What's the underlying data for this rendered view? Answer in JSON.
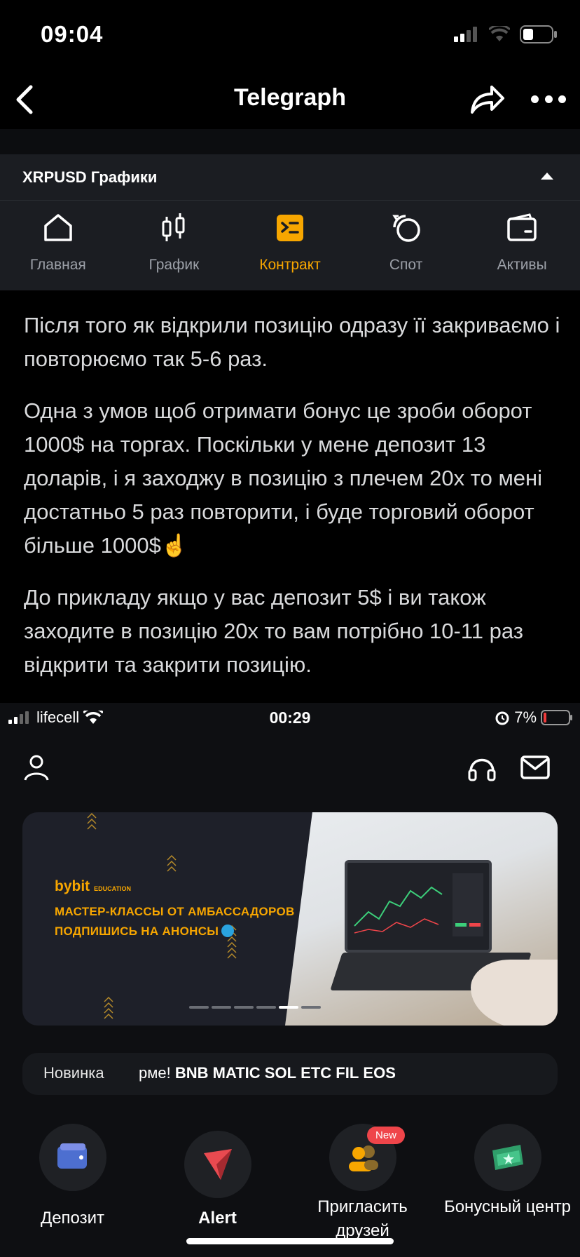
{
  "status_bar": {
    "time": "09:04"
  },
  "nav": {
    "title": "Telegraph"
  },
  "chart_page": {
    "pair_label": "XRPUSD Графики",
    "tabs": [
      {
        "label": "Главная",
        "icon": "home-icon"
      },
      {
        "label": "График",
        "icon": "candlestick-icon"
      },
      {
        "label": "Контракт",
        "icon": "contract-icon",
        "active": true
      },
      {
        "label": "Спот",
        "icon": "spot-icon"
      },
      {
        "label": "Активы",
        "icon": "wallet-icon"
      }
    ],
    "accent_color": "#f7a600"
  },
  "message": {
    "paragraphs": [
      "Після того як відкрили позицію одразу її закриваємо і повторюємо так 5-6 раз.",
      "Одна з умов щоб отримати бонус це зроби оборот 1000$ на торгах. Поскільки у мене депозит 13 доларів, і я заходжу в позицію з плечем 20х то мені достатньо 5 раз повторити, і буде торговий оборот більше 1000$☝️",
      "До прикладу якщо у вас депозит 5$ і ви також заходите в позицію 20х то вам потрібно 10-11 раз відкрити та закрити позицію."
    ]
  },
  "home_screen": {
    "status": {
      "carrier": "lifecell",
      "time": "00:29",
      "battery": "7%"
    },
    "banner": {
      "logo": "bybit",
      "logo_sub": "EDUCATION",
      "line1": "МАСТЕР-КЛАССЫ ОТ АМБАССАДОРОВ",
      "line2": "ПОДПИШИСЬ НА АНОНСЫ"
    },
    "ticker": {
      "label": "Новинка",
      "text_prefix": "рме!",
      "coins": [
        "BNB",
        "MATIC",
        "SOL",
        "ETC",
        "FIL",
        "EOS"
      ]
    },
    "quick_actions": [
      {
        "label": "Депозит",
        "icon": "wallet-card-icon"
      },
      {
        "label": "Alert",
        "icon": "alert-arrow-icon"
      },
      {
        "label": "Пригласить друзей",
        "icon": "invite-friends-icon",
        "badge": "New"
      },
      {
        "label": "Бонусный центр",
        "icon": "bonus-ticket-icon"
      }
    ]
  }
}
